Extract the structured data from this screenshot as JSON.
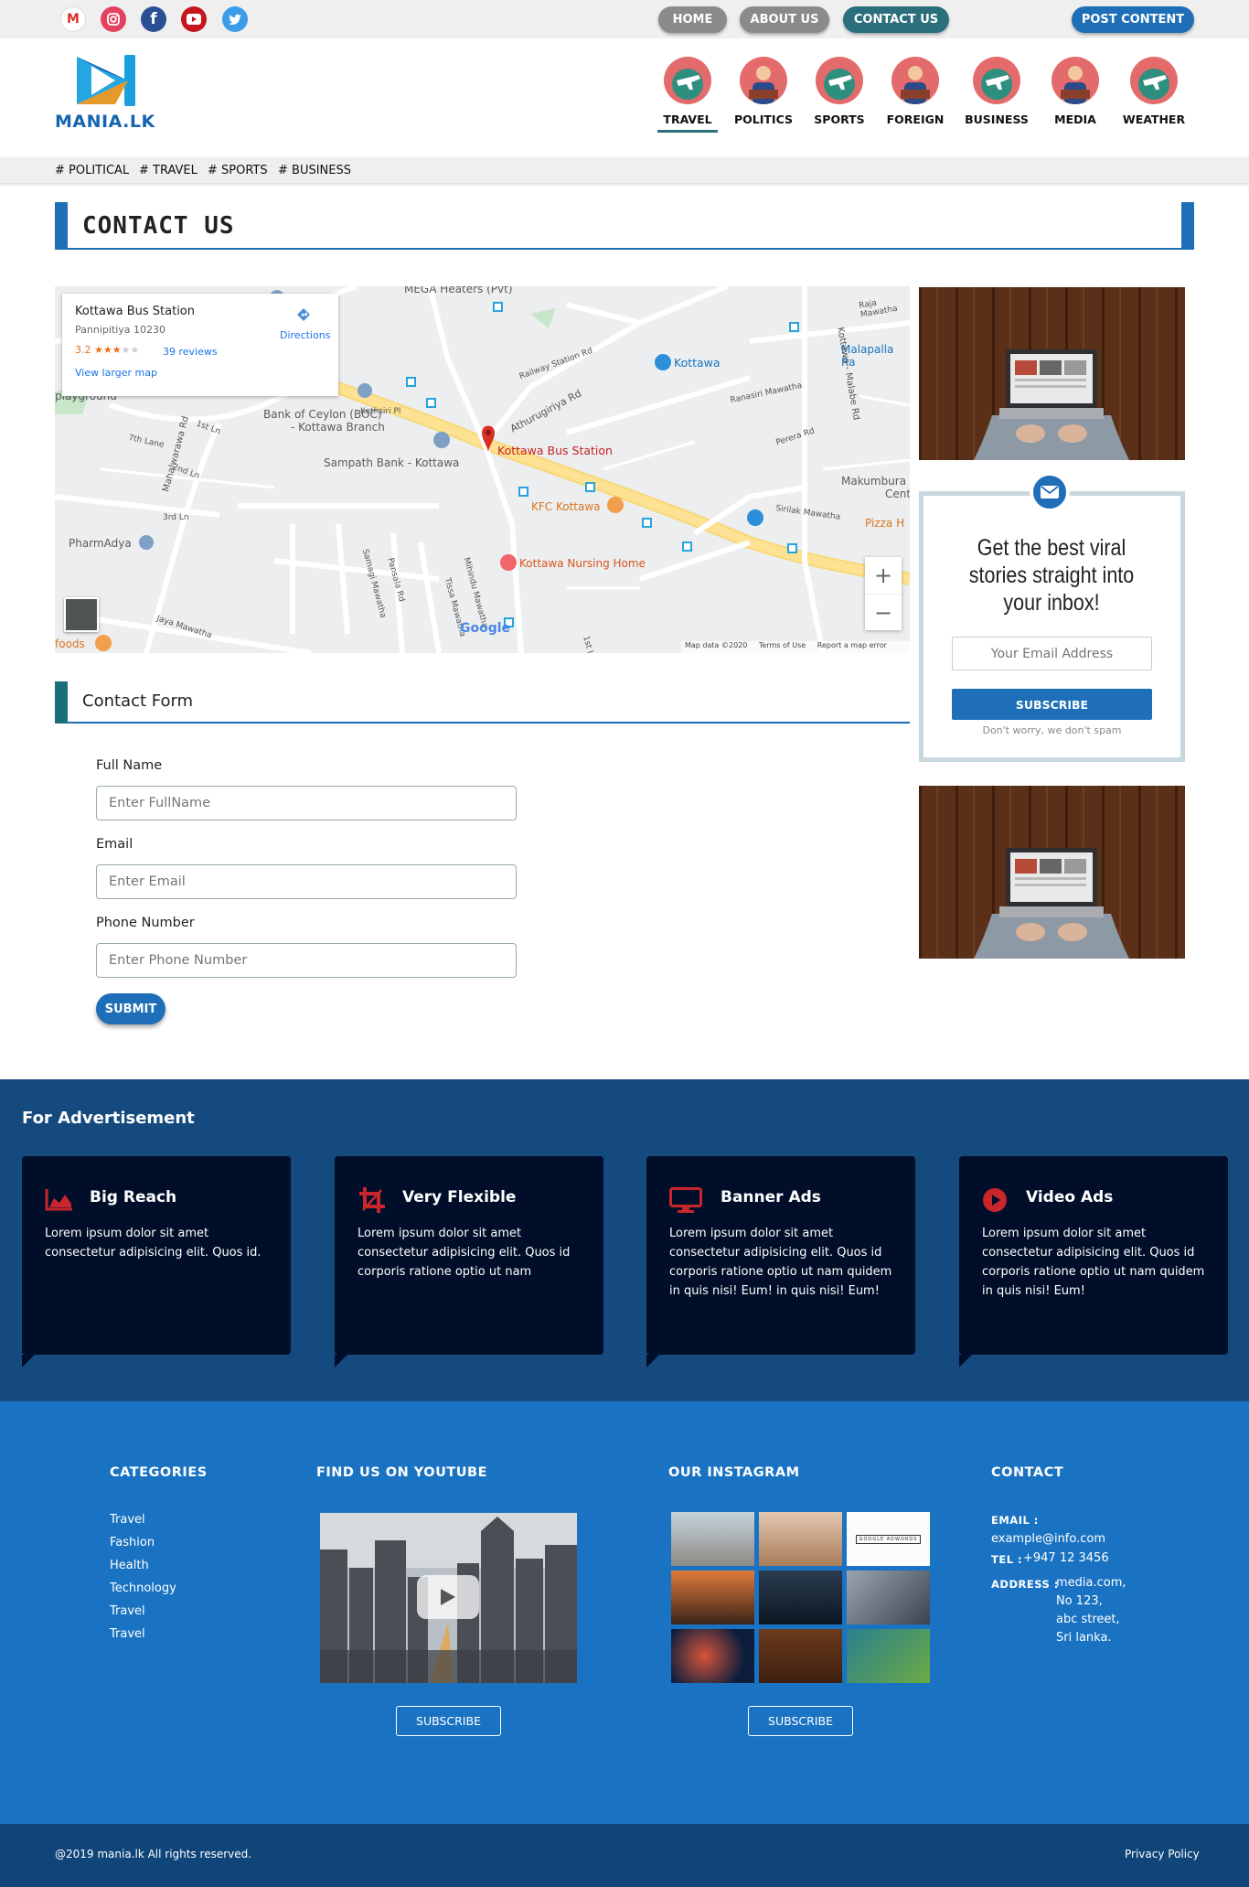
{
  "topbar": {
    "social": [
      "gmail-icon",
      "instagram-icon",
      "facebook-icon",
      "youtube-icon",
      "twitter-icon"
    ],
    "nav": [
      "HOME",
      "ABOUT US",
      "CONTACT US"
    ],
    "post_button": "POST CONTENT"
  },
  "brand": {
    "logo_text": "MANIA.LK"
  },
  "categories": [
    "TRAVEL",
    "POLITICS",
    "SPORTS",
    "FOREIGN",
    "BUSINESS",
    "MEDIA",
    "WEATHER"
  ],
  "tags": [
    "# POLITICAL",
    "# TRAVEL",
    "# SPORTS",
    "# BUSINESS"
  ],
  "page_title": "CONTACT US",
  "map": {
    "place": "Kottawa Bus Station",
    "address": "Pannipitiya 10230",
    "rating": "3.2",
    "stars": "★★★",
    "reviews": "39 reviews",
    "directions": "Directions",
    "larger_map": "View larger map",
    "pin_label": "Kottawa Bus Station",
    "labels": {
      "mega": "MEGA Heaters (Pvt)",
      "boc": "Bank of Ceylon (BOC)",
      "boc2": "- Kottawa Branch",
      "sampath": "Sampath Bank - Kottawa",
      "kfc": "KFC Kottawa",
      "nursing": "Kottawa Nursing Home",
      "pharm": "PharmAdya",
      "kottawa": "Kottawa",
      "malapalla": "Malapalla Ra",
      "makumbura": "Makumbura",
      "cent": "Cent",
      "pizza": "Pizza H",
      "foods": "foods",
      "playground": "playground",
      "google": "Google"
    },
    "roads": {
      "r1": "Athurugiriya Rd",
      "r2": "Railway Station Rd",
      "r3": "Mahalwarawa Rd",
      "r4": "Kottawa - Malabe Rd",
      "r5": "Pamunuwa Rd",
      "r6": "7th Lane",
      "r7": "1st Ln",
      "r8": "2nd Ln",
      "r9": "3rd Ln",
      "r10": "Jaya Mawatha",
      "r11": "Ranasiri Mawatha",
      "r12": "Sirilak Mawatha",
      "r13": "Perera Rd",
      "r14": "Raja Mawatha",
      "r15": "Kethsiri Pl",
      "r16": "Samagi Mawatha",
      "r17": "Pansala Rd",
      "r18": "Tissa Mawatha",
      "r19": "Mihindu Mawatha",
      "r20": "1st L"
    },
    "footer": [
      "Map data ©2020",
      "Terms of Use",
      "Report a map error"
    ],
    "zoom_in": "+",
    "zoom_out": "−"
  },
  "form": {
    "title": "Contact Form",
    "fields": [
      {
        "label": "Full Name",
        "placeholder": "Enter FullName"
      },
      {
        "label": "Email",
        "placeholder": "Enter Email"
      },
      {
        "label": "Phone Number",
        "placeholder": "Enter Phone Number"
      }
    ],
    "submit": "SUBMIT"
  },
  "newsletter": {
    "heading": "Get the best viral stories straight into your inbox!",
    "placeholder": "Your Email Address",
    "button": "SUBSCRIBE",
    "note": "Don't worry, we don't spam"
  },
  "advertisement": {
    "title": "For Advertisement",
    "cards": [
      {
        "icon": "area-chart-icon",
        "title": "Big Reach",
        "text": "Lorem ipsum dolor sit amet consectetur adipisicing elit. Quos id."
      },
      {
        "icon": "crop-icon",
        "title": "Very Flexible",
        "text": "Lorem ipsum dolor sit amet consectetur adipisicing elit. Quos id corporis ratione optio ut nam"
      },
      {
        "icon": "desktop-icon",
        "title": "Banner Ads",
        "text": "Lorem ipsum dolor sit amet consectetur adipisicing elit. Quos id corporis ratione optio ut nam quidem in quis nisi! Eum! in quis nisi! Eum!"
      },
      {
        "icon": "play-circle-icon",
        "title": "Video Ads",
        "text": "Lorem ipsum dolor sit amet consectetur adipisicing elit. Quos id corporis ratione optio ut nam quidem in quis nisi! Eum!"
      }
    ]
  },
  "footer": {
    "categories_title": "CATEGORIES",
    "categories": [
      "Travel",
      "Fashion",
      "Health",
      "Technology",
      "Travel",
      "Travel"
    ],
    "youtube_title": "FIND US ON YOUTUBE",
    "instagram_title": "OUR INSTAGRAM",
    "contact_title": "CONTACT",
    "email_label": "EMAIL :",
    "email": "example@info.com",
    "tel_label": "TEL :",
    "tel": "+947 12 3456",
    "address_label": "ADDRESS :",
    "address": [
      "media.com,",
      "No 123,",
      "abc street,",
      "Sri lanka."
    ],
    "subscribe": "SUBSCRIBE",
    "instagram_card_text": "GOOGLE ADWORDS"
  },
  "bottom": {
    "copyright": "@2019 mania.lk All rights reserved.",
    "privacy": "Privacy Policy"
  },
  "colors": {
    "primary": "#1e6fb8",
    "footer": "#1a73c2",
    "advert_bg": "#154a7e",
    "card_bg": "#000e29",
    "icon_red": "#c9252c",
    "teal_pill": "#2b6f7c"
  }
}
